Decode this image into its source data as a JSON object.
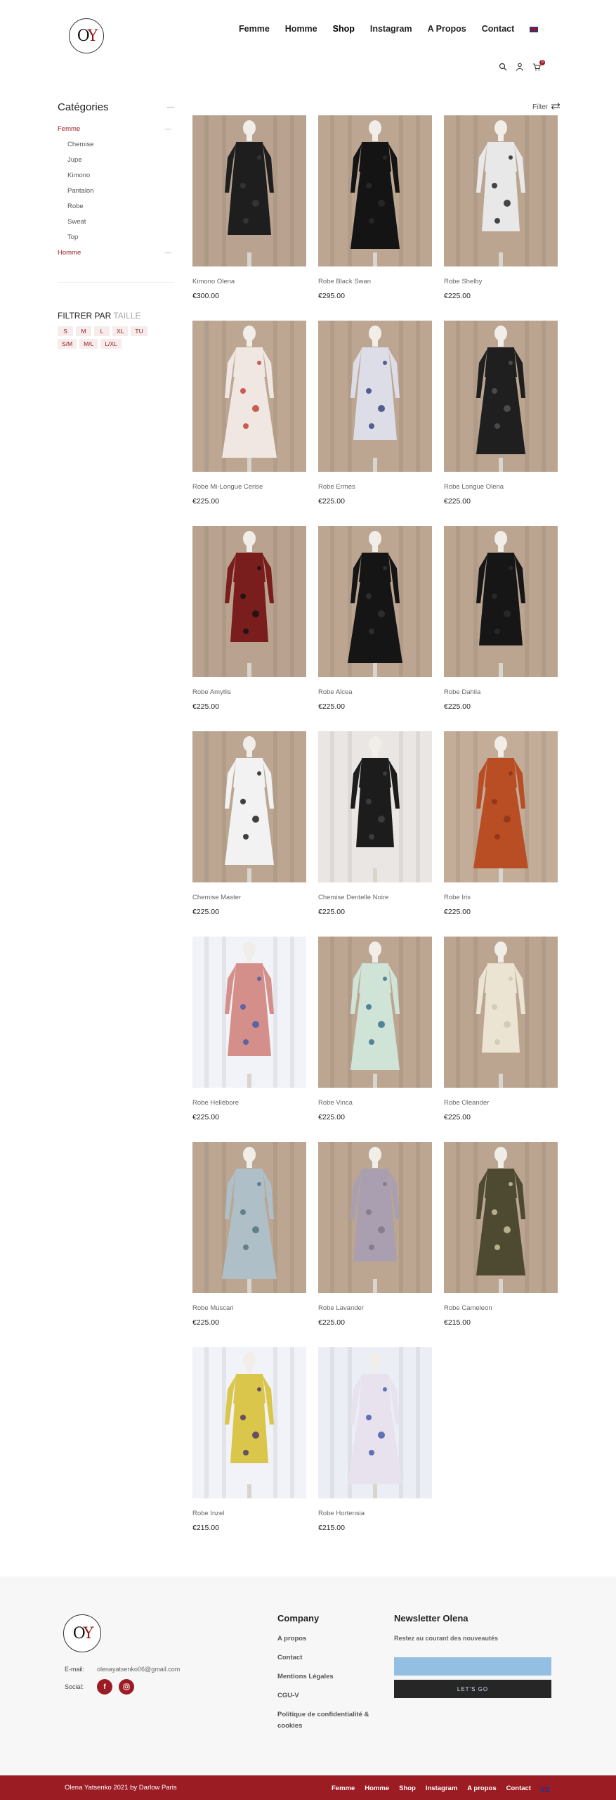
{
  "header": {
    "logo_text": "OY",
    "nav": [
      {
        "label": "Femme"
      },
      {
        "label": "Homme"
      },
      {
        "label": "Shop"
      },
      {
        "label": "Instagram"
      },
      {
        "label": "A Propos"
      },
      {
        "label": "Contact"
      }
    ],
    "cart_count": "0"
  },
  "sidebar": {
    "title": "Catégories",
    "categories": [
      {
        "label": "Femme",
        "level": "top"
      },
      {
        "label": "Chemise",
        "level": "sub"
      },
      {
        "label": "Jupe",
        "level": "sub"
      },
      {
        "label": "Kimono",
        "level": "sub"
      },
      {
        "label": "Pantalon",
        "level": "sub"
      },
      {
        "label": "Robe",
        "level": "sub"
      },
      {
        "label": "Sweat",
        "level": "sub"
      },
      {
        "label": "Top",
        "level": "sub"
      },
      {
        "label": "Homme",
        "level": "top"
      }
    ],
    "filter_title": "FILTRER PAR",
    "filter_sub": "TAILLE",
    "sizes": [
      "S",
      "M",
      "L",
      "XL",
      "TU",
      "S/M",
      "M/L",
      "L/XL"
    ]
  },
  "toolbar": {
    "filter_label": "Filter"
  },
  "products": [
    {
      "name": "Kimono Olena",
      "price": "€300.00",
      "bg": "#b9a390",
      "dress": "#1e1e1e",
      "accent": "#3a3a3a"
    },
    {
      "name": "Robe Black Swan",
      "price": "€295.00",
      "bg": "#bca692",
      "dress": "#141414",
      "accent": "#2a2a2a"
    },
    {
      "name": "Robe Shelby",
      "price": "€225.00",
      "bg": "#bba591",
      "dress": "#e8e8e8",
      "accent": "#1a1a1a"
    },
    {
      "name": "Robe Mi-Longue Cerise",
      "price": "€225.00",
      "bg": "#bda793",
      "dress": "#f0e6e2",
      "accent": "#c0392b"
    },
    {
      "name": "Robe Ermes",
      "price": "€225.00",
      "bg": "#bca692",
      "dress": "#dcdde6",
      "accent": "#2f3f78"
    },
    {
      "name": "Robe Longue Olena",
      "price": "€225.00",
      "bg": "#bba591",
      "dress": "#1f1f1f",
      "accent": "#555555"
    },
    {
      "name": "Robe Amyllis",
      "price": "€225.00",
      "bg": "#b9a390",
      "dress": "#7a1d1d",
      "accent": "#111111"
    },
    {
      "name": "Robe Alcea",
      "price": "€225.00",
      "bg": "#bca692",
      "dress": "#151515",
      "accent": "#333333"
    },
    {
      "name": "Robe Dahlia",
      "price": "€225.00",
      "bg": "#bba591",
      "dress": "#161616",
      "accent": "#2c2c2c"
    },
    {
      "name": "Chemise Master",
      "price": "€225.00",
      "bg": "#bca692",
      "dress": "#f2f2f2",
      "accent": "#111111"
    },
    {
      "name": "Chemise Dentelle Noire",
      "price": "€225.00",
      "bg": "#e9e6e3",
      "dress": "#1c1c1c",
      "accent": "#444444"
    },
    {
      "name": "Robe Iris",
      "price": "€225.00",
      "bg": "#c3ad98",
      "dress": "#b94e24",
      "accent": "#8a3518"
    },
    {
      "name": "Robe Hellébore",
      "price": "€225.00",
      "bg": "#f2f3f8",
      "dress": "#d58f8a",
      "accent": "#3d5aa8"
    },
    {
      "name": "Robe Vinca",
      "price": "€225.00",
      "bg": "#bca692",
      "dress": "#cfe3d6",
      "accent": "#2f6b8a"
    },
    {
      "name": "Robe Oleander",
      "price": "€225.00",
      "bg": "#bba591",
      "dress": "#ebe4d2",
      "accent": "#cfc6b0"
    },
    {
      "name": "Robe Muscari",
      "price": "€225.00",
      "bg": "#bca692",
      "dress": "#aebfc7",
      "accent": "#4f6f7a"
    },
    {
      "name": "Robe Lavander",
      "price": "€225.00",
      "bg": "#bca692",
      "dress": "#a99fb0",
      "accent": "#7e7488"
    },
    {
      "name": "Robe Cameleon",
      "price": "€215.00",
      "bg": "#bba591",
      "dress": "#4e4a32",
      "accent": "#cfc8a2"
    },
    {
      "name": "Robe Inzel",
      "price": "€215.00",
      "bg": "#f2f3f8",
      "dress": "#d9c64a",
      "accent": "#4a2f6b"
    },
    {
      "name": "Robe Hortensia",
      "price": "€215.00",
      "bg": "#eceef6",
      "dress": "#e8e2ee",
      "accent": "#3b55a8"
    }
  ],
  "footer": {
    "logo_text": "OY",
    "email_label": "E-mail:",
    "email_value": "olenayatsenko06@gmail.com",
    "social_label": "Social:",
    "company_title": "Company",
    "company_links": [
      "A propos",
      "Contact",
      "Mentions Légales",
      "CGU-V",
      "Politique de confidentialité & cookies"
    ],
    "newsletter_title": "Newsletter Olena",
    "newsletter_sub": "Restez au courant des nouveautés",
    "newsletter_button": "LET'S GO"
  },
  "bottom_bar": {
    "copyright": "Olena Yatsenko 2021 by Darlow Paris",
    "nav": [
      "Femme",
      "Homme",
      "Shop",
      "Instagram",
      "A propos",
      "Contact"
    ]
  },
  "colors": {
    "brand": "#9c1c24",
    "newsletter_input": "#93bfe3"
  }
}
